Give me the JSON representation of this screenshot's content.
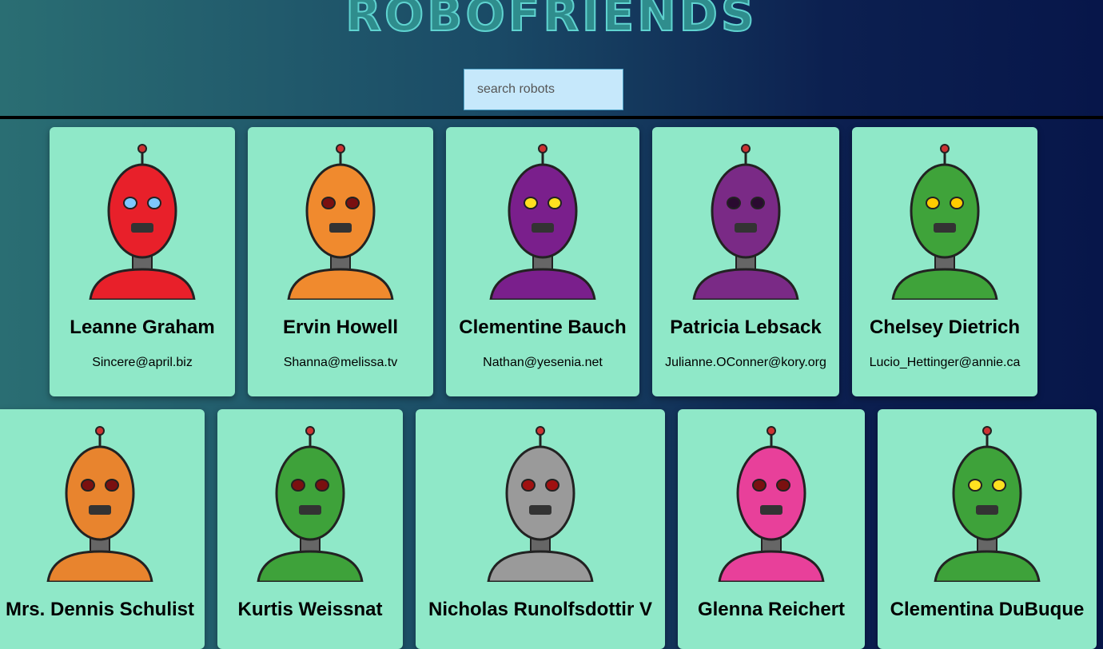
{
  "header": {
    "title": "ROBOFRIENDS"
  },
  "search": {
    "placeholder": "search robots",
    "value": ""
  },
  "robots": [
    {
      "name": "Leanne Graham",
      "email": "Sincere@april.biz",
      "color": "#e8202a",
      "eye": "#7ec8ff"
    },
    {
      "name": "Ervin Howell",
      "email": "Shanna@melissa.tv",
      "color": "#f08a2e",
      "eye": "#7a1010"
    },
    {
      "name": "Clementine Bauch",
      "email": "Nathan@yesenia.net",
      "color": "#7a1f8c",
      "eye": "#ffe020"
    },
    {
      "name": "Patricia Lebsack",
      "email": "Julianne.OConner@kory.org",
      "color": "#7a2a86",
      "eye": "#2a0a30"
    },
    {
      "name": "Chelsey Dietrich",
      "email": "Lucio_Hettinger@annie.ca",
      "color": "#3fa33a",
      "eye": "#ffcc00"
    },
    {
      "name": "Mrs. Dennis Schulist",
      "email": "",
      "color": "#e8842e",
      "eye": "#7a1010"
    },
    {
      "name": "Kurtis Weissnat",
      "email": "",
      "color": "#3ea23a",
      "eye": "#7a1010"
    },
    {
      "name": "Nicholas Runolfsdottir V",
      "email": "",
      "color": "#9a9a9a",
      "eye": "#a01010"
    },
    {
      "name": "Glenna Reichert",
      "email": "",
      "color": "#e8409a",
      "eye": "#7a1010"
    },
    {
      "name": "Clementina DuBuque",
      "email": "",
      "color": "#3ea23a",
      "eye": "#ffe020"
    }
  ]
}
